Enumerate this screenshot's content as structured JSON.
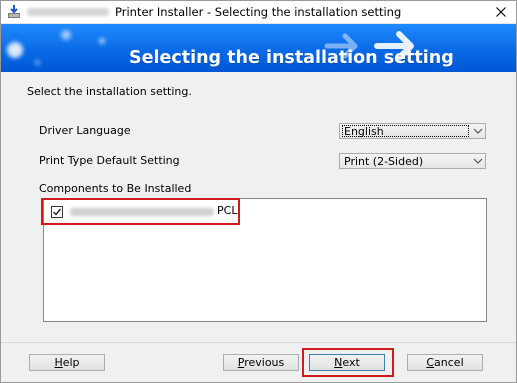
{
  "window": {
    "title": "Printer Installer - Selecting the installation setting",
    "close_glyph": "✕"
  },
  "banner": {
    "title": "Selecting the installation setting"
  },
  "instruction": "Select the installation setting.",
  "settings": {
    "driver_language": {
      "label": "Driver Language",
      "value": "English"
    },
    "print_type": {
      "label": "Print Type Default Setting",
      "value": "Print (2-Sided)"
    }
  },
  "components": {
    "label": "Components to Be Installed",
    "items": [
      {
        "name_suffix": "PCL",
        "checked": true
      }
    ]
  },
  "buttons": {
    "help": {
      "mnemonic": "H",
      "rest": "elp"
    },
    "previous": {
      "mnemonic": "P",
      "rest": "revious"
    },
    "next": {
      "mnemonic": "N",
      "rest": "ext"
    },
    "cancel": {
      "mnemonic": "C",
      "rest": "ancel"
    }
  },
  "icons": {
    "app": "printer-download-icon",
    "close": "close-icon",
    "dropdown": "chevron-down-icon",
    "check": "checkmark-icon"
  },
  "colors": {
    "banner_blue": "#0a6ae6",
    "highlight_red": "#d11a1a",
    "focus_border": "#3c7fb1"
  }
}
